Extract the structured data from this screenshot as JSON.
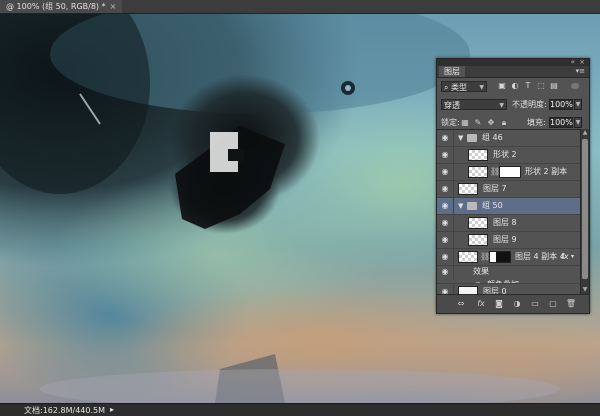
{
  "document": {
    "tab_title": "@ 100% (组 50, RGB/8) *",
    "tab_close": "×"
  },
  "layers_panel": {
    "collapse_icon": "double-chevron-icon",
    "close_icon": "close-icon",
    "tab_label": "图层",
    "menu_icon": "panel-menu-icon",
    "filter": {
      "search_icon": "search-icon",
      "kind_label": "类型",
      "filter_icons": [
        "image-filter-icon",
        "adjustment-filter-icon",
        "type-filter-icon",
        "shape-filter-icon",
        "smart-object-filter-icon"
      ]
    },
    "blend_mode": "穿透",
    "opacity_label": "不透明度:",
    "opacity_value": "100%",
    "lock_label": "锁定:",
    "fill_label": "填充:",
    "fill_value": "100%",
    "lock_icons": [
      "lock-transparency-icon",
      "lock-image-icon",
      "lock-position-icon",
      "lock-all-icon"
    ],
    "layers": [
      {
        "name": "组 46",
        "type": "group",
        "expanded": true,
        "indent": 0,
        "selected": false
      },
      {
        "name": "形状 2",
        "type": "layer",
        "indent": 1,
        "selected": false,
        "thumb": "checker"
      },
      {
        "name": "形状 2 副本",
        "type": "layer-mask",
        "indent": 1,
        "selected": false,
        "thumb": "checker",
        "mask": "white"
      },
      {
        "name": "图层 7",
        "type": "layer",
        "indent": 0,
        "selected": false,
        "thumb": "checker"
      },
      {
        "name": "组 50",
        "type": "group",
        "expanded": true,
        "indent": 0,
        "selected": true
      },
      {
        "name": "图层 8",
        "type": "layer",
        "indent": 1,
        "selected": false,
        "thumb": "checker"
      },
      {
        "name": "图层 9",
        "type": "layer",
        "indent": 1,
        "selected": false,
        "thumb": "checker"
      },
      {
        "name": "图层 4 副本 4",
        "type": "layer-mask-fx",
        "indent": 0,
        "selected": false,
        "thumb": "checker",
        "mask": "black",
        "fx": "fx",
        "fx_expand": "▾"
      },
      {
        "name": "效果",
        "type": "effects-header",
        "indent": 1
      },
      {
        "name": "颜色叠加",
        "type": "effect",
        "indent": 2
      },
      {
        "name": "图层 0",
        "type": "layer",
        "indent": 0,
        "selected": false,
        "thumb": "white"
      }
    ],
    "bottom_icons": [
      "link-layers-icon",
      "fx-icon",
      "add-mask-icon",
      "adjustment-layer-icon",
      "new-group-icon",
      "new-layer-icon",
      "delete-layer-icon"
    ]
  },
  "status": {
    "doc_info": "文档:162.8M/440.5M",
    "menu_arrow": "▸"
  },
  "colors": {
    "panel_bg": "#535353",
    "selected_row": "#5e6e88",
    "ui_dark": "#3c3c3c"
  }
}
